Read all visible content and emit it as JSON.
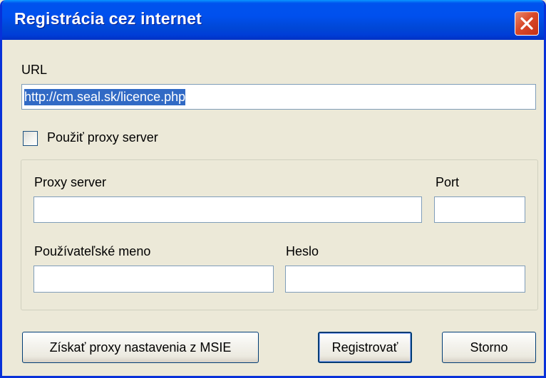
{
  "window": {
    "title": "Registrácia cez internet"
  },
  "url": {
    "label": "URL",
    "value": "http://cm.seal.sk/licence.php"
  },
  "proxy": {
    "use_proxy_label": "Použiť proxy server",
    "use_proxy_checked": false,
    "server_label": "Proxy server",
    "server_value": "",
    "port_label": "Port",
    "port_value": "",
    "username_label": "Používateľské meno",
    "username_value": "",
    "password_label": "Heslo",
    "password_value": ""
  },
  "buttons": {
    "get_proxy_label": "Získať proxy nastavenia z MSIE",
    "register_label": "Registrovať",
    "cancel_label": "Storno"
  },
  "colors": {
    "titlebar": "#0053ee",
    "dialog_background": "#ece9d8",
    "selection": "#316ac5",
    "close_button": "#d9492a"
  },
  "icons": {
    "close": "close-icon"
  }
}
